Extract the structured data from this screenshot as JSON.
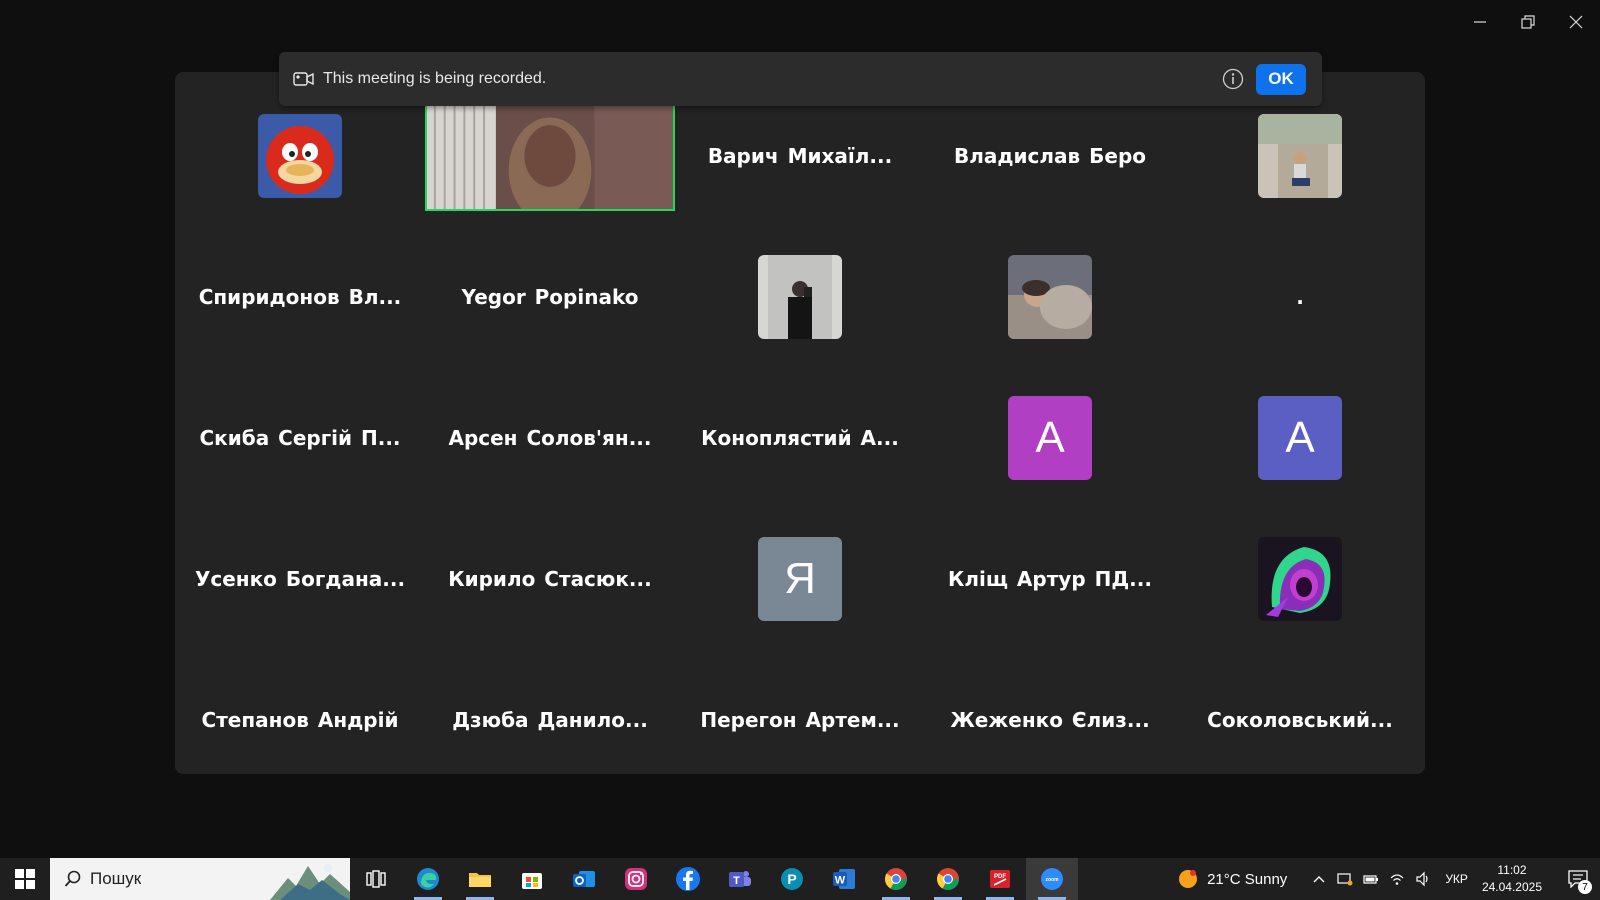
{
  "banner": {
    "text": "This meeting is being recorded.",
    "ok_label": "OK"
  },
  "participants": [
    {
      "name": "",
      "kind": "avatar",
      "image": "red-cartoon-character"
    },
    {
      "name": "",
      "kind": "video",
      "image": "woman-webcam"
    },
    {
      "name": "Варич Михаїл...",
      "kind": "name"
    },
    {
      "name": "Владислав Беро",
      "kind": "name"
    },
    {
      "name": "",
      "kind": "avatar",
      "image": "person-sitting-outdoors"
    },
    {
      "name": "Спиридонов Вл...",
      "kind": "name"
    },
    {
      "name": "Yegor Popinako",
      "kind": "name"
    },
    {
      "name": "",
      "kind": "avatar",
      "image": "mirror-selfie"
    },
    {
      "name": "",
      "kind": "avatar",
      "image": "person-lying"
    },
    {
      "name": ".",
      "kind": "name"
    },
    {
      "name": "Скиба Сергій П...",
      "kind": "name"
    },
    {
      "name": "Арсен Солов'ян...",
      "kind": "name"
    },
    {
      "name": "Коноплястий А...",
      "kind": "name"
    },
    {
      "name": "",
      "kind": "letter",
      "letter": "A",
      "color": "#b13fc3"
    },
    {
      "name": "",
      "kind": "letter",
      "letter": "A",
      "color": "#5b5fc4"
    },
    {
      "name": "Усенко Богдана...",
      "kind": "name"
    },
    {
      "name": "Кирило Стасюк...",
      "kind": "name"
    },
    {
      "name": "",
      "kind": "letter",
      "letter": "Я",
      "color": "#7a8896"
    },
    {
      "name": "Кліщ Артур ПД...",
      "kind": "name"
    },
    {
      "name": "",
      "kind": "avatar",
      "image": "hooded-figure-art"
    },
    {
      "name": "Степанов Андрій",
      "kind": "name"
    },
    {
      "name": "Дзюба Данило...",
      "kind": "name"
    },
    {
      "name": "Перегон Артем...",
      "kind": "name"
    },
    {
      "name": "Жеженко Єлиз...",
      "kind": "name"
    },
    {
      "name": "Соколовський...",
      "kind": "name"
    }
  ],
  "taskbar": {
    "search_placeholder": "Пошук",
    "apps": [
      "task-view-icon",
      "edge-icon",
      "file-explorer-icon",
      "store-icon",
      "outlook-icon",
      "instagram-icon",
      "facebook-icon",
      "teams-icon",
      "pearson-icon",
      "word-icon",
      "chrome-icon",
      "chrome-icon-2",
      "pdf-icon",
      "zoom-icon"
    ],
    "weather": "21°C  Sunny",
    "language": "УКР",
    "time": "11:02",
    "date": "24.04.2025",
    "notification_count": "7"
  },
  "colors": {
    "accent": "#0e72ed",
    "active_speaker": "#23d959",
    "gallery_bg": "#232323"
  }
}
